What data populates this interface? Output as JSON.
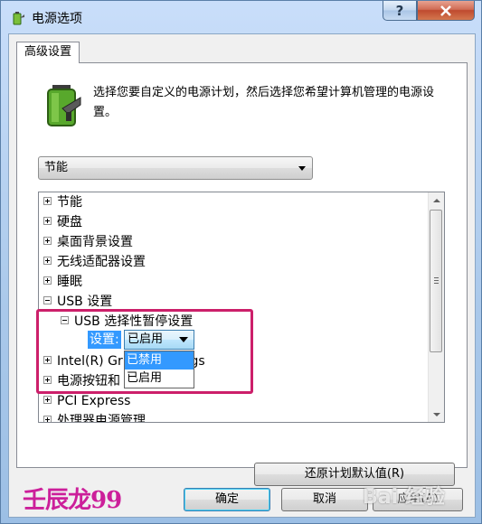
{
  "window": {
    "title": "电源选项"
  },
  "tabs": [
    {
      "label": "高级设置"
    }
  ],
  "description": "选择您要自定义的电源计划，然后选择您希望计算机管理的电源设置。",
  "plan_select": {
    "value": "节能"
  },
  "tree": {
    "items": [
      {
        "label": "节能",
        "expander": "plus"
      },
      {
        "label": "硬盘",
        "expander": "plus"
      },
      {
        "label": "桌面背景设置",
        "expander": "plus"
      },
      {
        "label": "无线适配器设置",
        "expander": "plus"
      },
      {
        "label": "睡眠",
        "expander": "plus"
      },
      {
        "label": "USB 设置",
        "expander": "minus"
      },
      {
        "label": "USB 选择性暂停设置",
        "expander": "minus"
      },
      {
        "label": "Intel(R) Gr",
        "label_tail": "ings",
        "expander": "plus"
      },
      {
        "label": "电源按钮和",
        "expander": "plus"
      },
      {
        "label": "PCI Express",
        "expander": "plus"
      },
      {
        "label": "处理器电源管理",
        "expander": "plus"
      }
    ],
    "setting_label": "设置:",
    "setting_value": "已启用",
    "dropdown_options": [
      "已禁用",
      "已启用"
    ],
    "dropdown_selected_index": 0
  },
  "buttons": {
    "restore_label": "还原计划默认值(R)",
    "ok_label": "确定",
    "cancel_label": "取消",
    "apply_label": "应用(A)"
  },
  "watermark": "壬辰龙99",
  "baidu_watermark": "Bai 经验",
  "colors": {
    "highlight": "#cc1f6a",
    "selection": "#3399ff",
    "watermark": "#cc1f9a"
  }
}
